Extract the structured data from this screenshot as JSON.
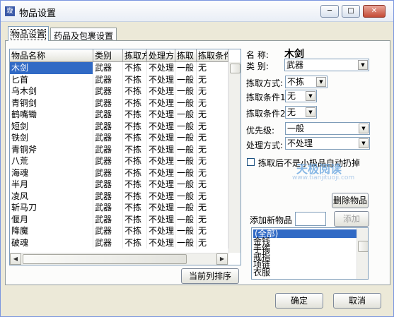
{
  "window": {
    "title": "物品设置",
    "icon": "app-icon"
  },
  "titlebar_buttons": {
    "minimize": "─",
    "maximize": "□",
    "close": "✕"
  },
  "tabs": [
    {
      "label": "物品设置",
      "active": true
    },
    {
      "label": "药品及包裹设置",
      "active": false
    }
  ],
  "table": {
    "columns": [
      "物品名称",
      "类别",
      "拣取方",
      "处理方",
      "拣取",
      "拣取条件"
    ],
    "rows": [
      [
        "木剑",
        "武器",
        "不拣",
        "不处理",
        "一般",
        "无"
      ],
      [
        "匕首",
        "武器",
        "不拣",
        "不处理",
        "一般",
        "无"
      ],
      [
        "乌木剑",
        "武器",
        "不拣",
        "不处理",
        "一般",
        "无"
      ],
      [
        "青铜剑",
        "武器",
        "不拣",
        "不处理",
        "一般",
        "无"
      ],
      [
        "鹤嘴锄",
        "武器",
        "不拣",
        "不处理",
        "一般",
        "无"
      ],
      [
        "短剑",
        "武器",
        "不拣",
        "不处理",
        "一般",
        "无"
      ],
      [
        "铁剑",
        "武器",
        "不拣",
        "不处理",
        "一般",
        "无"
      ],
      [
        "青铜斧",
        "武器",
        "不拣",
        "不处理",
        "一般",
        "无"
      ],
      [
        "八荒",
        "武器",
        "不拣",
        "不处理",
        "一般",
        "无"
      ],
      [
        "海魂",
        "武器",
        "不拣",
        "不处理",
        "一般",
        "无"
      ],
      [
        "半月",
        "武器",
        "不拣",
        "不处理",
        "一般",
        "无"
      ],
      [
        "凌风",
        "武器",
        "不拣",
        "不处理",
        "一般",
        "无"
      ],
      [
        "斩马刀",
        "武器",
        "不拣",
        "不处理",
        "一般",
        "无"
      ],
      [
        "偃月",
        "武器",
        "不拣",
        "不处理",
        "一般",
        "无"
      ],
      [
        "降魔",
        "武器",
        "不拣",
        "不处理",
        "一般",
        "无"
      ],
      [
        "破魂",
        "武器",
        "不拣",
        "不处理",
        "一般",
        "无"
      ]
    ],
    "selected_row": 0
  },
  "sort_button": "当前列排序",
  "detail": {
    "name_label": "名  称:",
    "name_value": "木剑",
    "category_label": "类  别:",
    "category_value": "武器",
    "pickup_label": "拣取方式:",
    "pickup_value": "不拣",
    "cond1_label": "拣取条件1",
    "cond1_value": "无",
    "cond2_label": "拣取条件2",
    "cond2_value": "无",
    "priority_label": "优先级:",
    "priority_value": "一般",
    "handle_label": "处理方式:",
    "handle_value": "不处理",
    "auto_drop_label": "拣取后不是小极品自动扔掉",
    "auto_drop_checked": false
  },
  "delete_button": "删除物品",
  "add_label": "添加新物品",
  "add_input_value": "",
  "add_button": "添加",
  "category_list": [
    "(全部)",
    "金钱",
    "手镯",
    "戒指",
    "项链",
    "衣服"
  ],
  "category_list_selected": 0,
  "ok_button": "确定",
  "cancel_button": "取消",
  "watermark": {
    "line1": "天极阅读",
    "line2": "www.tianjituoji.com"
  }
}
